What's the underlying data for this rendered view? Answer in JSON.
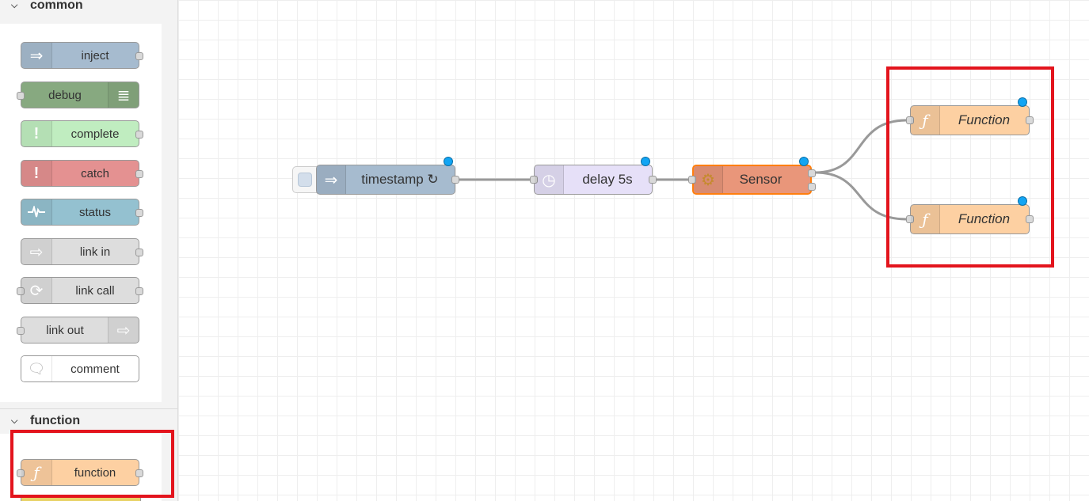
{
  "palette": {
    "categories": [
      {
        "label": "common"
      },
      {
        "label": "function"
      }
    ],
    "nodes": {
      "inject": "inject",
      "debug": "debug",
      "complete": "complete",
      "catch": "catch",
      "status": "status",
      "link_in": "link in",
      "link_call": "link call",
      "link_out": "link out",
      "comment": "comment",
      "function": "function"
    }
  },
  "flow": {
    "nodes": {
      "timestamp": "timestamp ↻",
      "delay": "delay 5s",
      "sensor": "Sensor",
      "function_1": "Function",
      "function_2": "Function"
    }
  },
  "colors": {
    "inject": "#a6bbcf",
    "debug": "#87a980",
    "complete": "#c0edc0",
    "catch": "#e49191",
    "status": "#94c1d0",
    "link": "#dddddd",
    "comment": "#ffffff",
    "function": "#fdd0a2",
    "delay": "#e6e0f8",
    "sensor": "#e9967a",
    "highlight": "#e3141d",
    "status_dot": "#12a5f4"
  }
}
